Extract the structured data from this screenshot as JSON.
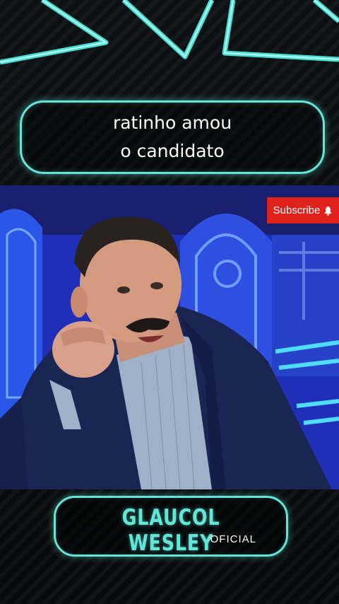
{
  "caption": {
    "line1": "ratinho amou",
    "line2": "o candidato"
  },
  "subscribe": {
    "label": "Subscribe",
    "icon": "bell-icon",
    "color": "#e0211c"
  },
  "branding": {
    "name": "GLAUCOL WESLEY",
    "subtitle": "OFICIAL",
    "accent": "#63e6d8"
  }
}
